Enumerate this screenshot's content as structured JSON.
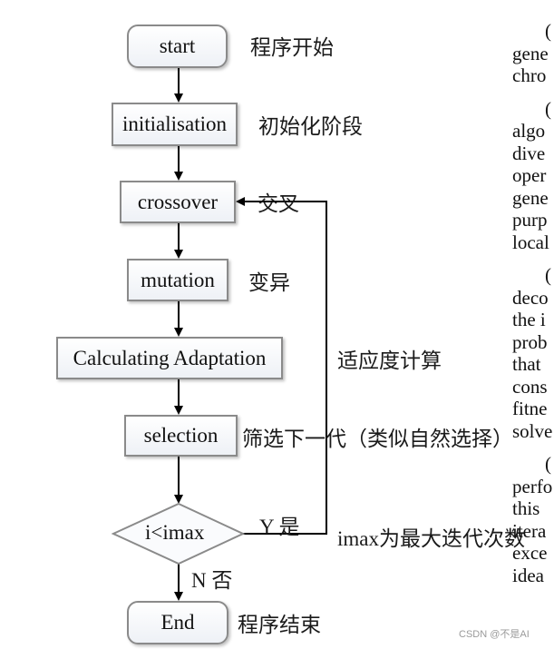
{
  "flowchart": {
    "nodes": [
      {
        "id": "start",
        "label": "start",
        "shape": "rounded",
        "note": "程序开始"
      },
      {
        "id": "initialisation",
        "label": "initialisation",
        "shape": "rect",
        "note": "初始化阶段"
      },
      {
        "id": "crossover",
        "label": "crossover",
        "shape": "rect",
        "note": "交叉"
      },
      {
        "id": "mutation",
        "label": "mutation",
        "shape": "rect",
        "note": "变异"
      },
      {
        "id": "calculating",
        "label": "Calculating Adaptation",
        "shape": "rect",
        "note": "适应度计算"
      },
      {
        "id": "selection",
        "label": "selection",
        "shape": "rect",
        "note": "筛选下一代（类似自然选择）"
      },
      {
        "id": "decision",
        "label": "i<imax",
        "shape": "diamond",
        "note": "imax为最大迭代次数"
      },
      {
        "id": "end",
        "label": "End",
        "shape": "rounded",
        "note": "程序结束"
      }
    ],
    "edges": {
      "yes_label": "Y 是",
      "no_label": "N 否"
    }
  },
  "paper_fragments": [
    "(",
    "gene",
    "chro",
    "(",
    "algo",
    "dive",
    "oper",
    "gene",
    "purp",
    "local",
    "(",
    "deco",
    "the i",
    "prob",
    "that",
    "cons",
    "fitne",
    "solve",
    "(",
    "perfo",
    "this",
    "itera",
    "exce",
    "idea"
  ],
  "watermark": "CSDN @不是AI",
  "colors": {
    "border": "#8a8a8a",
    "fill_top": "#ffffff",
    "fill_bottom": "#eef1f6",
    "line": "#000000"
  }
}
